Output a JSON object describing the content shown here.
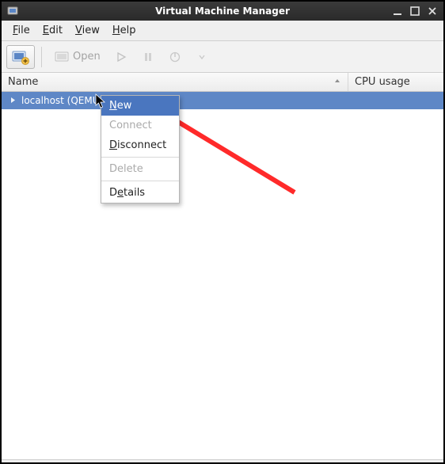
{
  "titlebar": {
    "title": "Virtual Machine Manager",
    "icon_name": "vm-icon"
  },
  "menubar": {
    "file": {
      "label": "File",
      "mnemonic": "F"
    },
    "edit": {
      "label": "Edit",
      "mnemonic": "E"
    },
    "view": {
      "label": "View",
      "mnemonic": "V"
    },
    "help": {
      "label": "Help",
      "mnemonic": "H"
    }
  },
  "toolbar": {
    "new_vm_tooltip": "Create a new virtual machine",
    "open_label": "Open"
  },
  "columns": {
    "name": "Name",
    "cpu": "CPU usage"
  },
  "connections": [
    {
      "label": "localhost (QEMU)",
      "selected": true
    }
  ],
  "context_menu": {
    "new": "New",
    "connect": "Connect",
    "disconnect": "Disconnect",
    "delete": "Delete",
    "details": "Details"
  }
}
